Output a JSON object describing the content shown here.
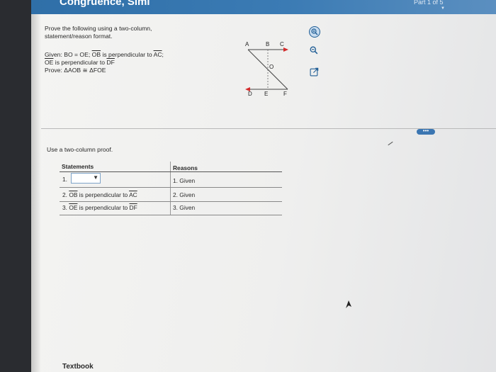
{
  "header": {
    "title": "Congruence, Simi",
    "part": "Part 1 of 5",
    "caret": "▼"
  },
  "problem": {
    "intro_line1": "Prove the following using a two-column,",
    "intro_line2": "statement/reason format.",
    "given_prefix": "Given: BO = OE; ",
    "given_ob": "OB",
    "given_mid": " is perpendicular to ",
    "given_ac": "AC",
    "given_end": ";",
    "line2_oe": "OE",
    "line2_mid": " is perpendicular to ",
    "line2_df": "DF",
    "prove": "Prove: ΔAOB ≅ ΔFOE"
  },
  "figure": {
    "labels": {
      "A": "A",
      "B": "B",
      "C": "C",
      "O": "O",
      "D": "D",
      "E": "E",
      "F": "F"
    },
    "accent": "#d42b2b"
  },
  "tools": [
    "zoom-in-icon",
    "zoom-out-icon",
    "open-external-icon"
  ],
  "instruction": "Use a two-column proof.",
  "proof": {
    "statements_header": "Statements",
    "reasons_header": "Reasons",
    "rows": [
      {
        "num": "1.",
        "statement": "",
        "reason": "1. Given"
      },
      {
        "num": "2.",
        "seg": "OB",
        "statement": " is perpendicular to ",
        "seg2": "AC",
        "reason": "2. Given"
      },
      {
        "num": "3.",
        "seg": "OE",
        "statement": " is perpendicular to ",
        "seg2": "DF",
        "reason": "3. Given"
      }
    ]
  },
  "more_label": "•••",
  "footer": {
    "textbook": "Textbook"
  },
  "colors": {
    "header": "#2f6fa8",
    "icon": "#1f5d95"
  }
}
